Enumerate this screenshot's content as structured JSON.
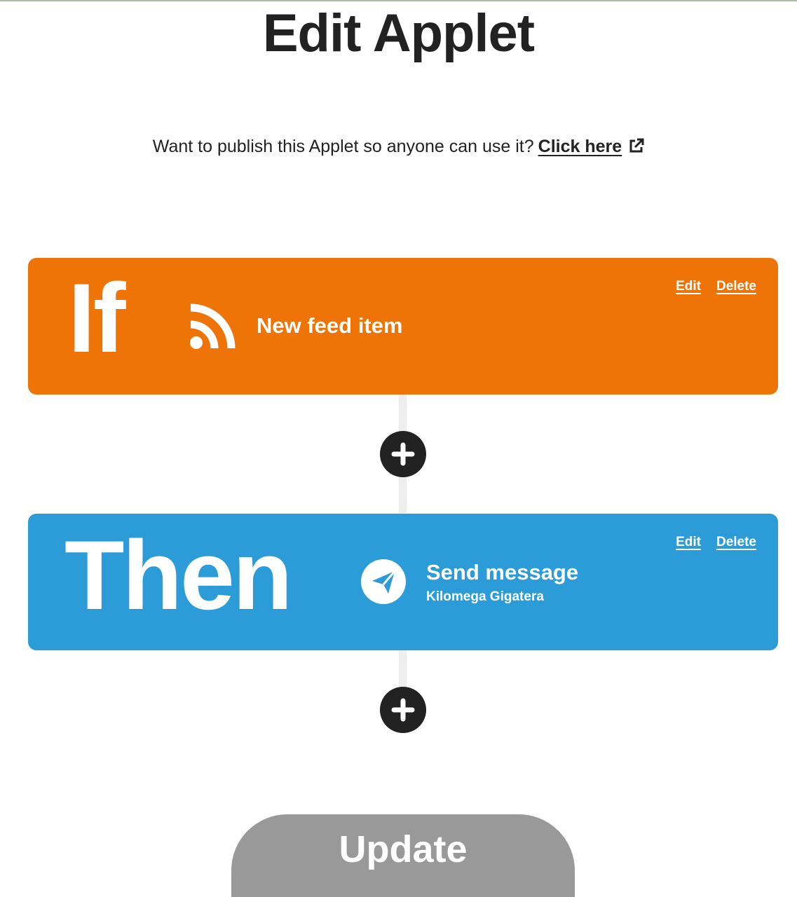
{
  "page": {
    "title": "Edit Applet"
  },
  "publish": {
    "prompt": "Want to publish this Applet so anyone can use it?",
    "link_label": "Click here",
    "link_icon": "external-link-icon"
  },
  "trigger": {
    "keyword": "If",
    "service_icon": "rss-feed-icon",
    "title": "New feed item",
    "edit_label": "Edit",
    "delete_label": "Delete",
    "color": "#ee7407"
  },
  "action": {
    "keyword": "Then",
    "service_icon": "telegram-icon",
    "title": "Send message",
    "subtitle": "Kilomega Gigatera",
    "edit_label": "Edit",
    "delete_label": "Delete",
    "color": "#2b9cd8"
  },
  "add_step": {
    "icon": "plus-icon"
  },
  "footer": {
    "update_label": "Update",
    "update_color": "#999999"
  }
}
